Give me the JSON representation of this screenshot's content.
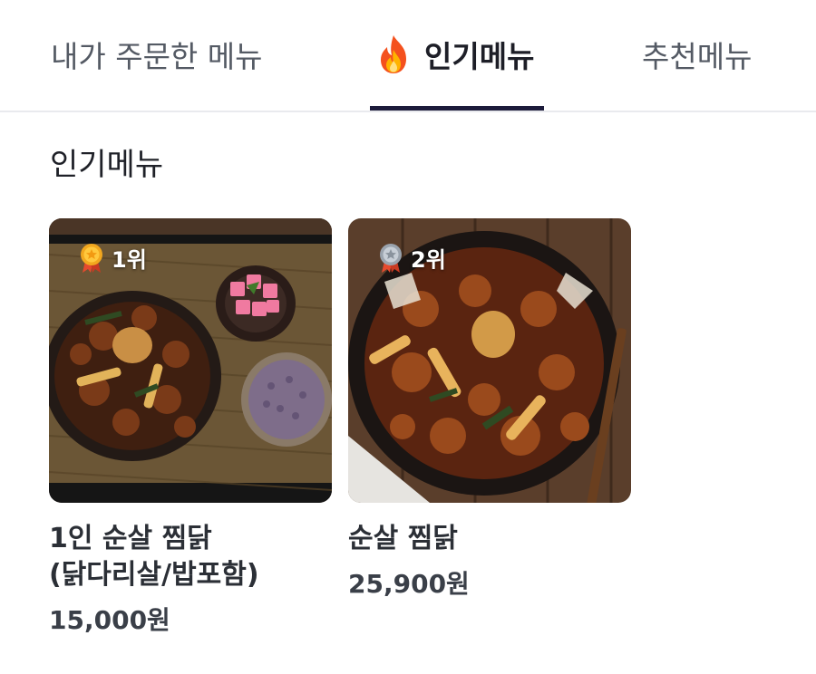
{
  "tabs": [
    {
      "label": "내가 주문한 메뉴",
      "active": false
    },
    {
      "label": "인기메뉴",
      "active": true,
      "icon": "fire-icon"
    },
    {
      "label": "추천메뉴",
      "active": false
    }
  ],
  "section": {
    "title": "인기메뉴"
  },
  "menus": [
    {
      "rank": "1위",
      "rank_icon": "gold-medal-icon",
      "name_line1": "1인 순살 찜닭",
      "name_line2": "(닭다리살/밥포함)",
      "price": "15,000원"
    },
    {
      "rank": "2위",
      "rank_icon": "silver-medal-icon",
      "name_line1": "순살 찜닭",
      "name_line2": "",
      "price": "25,900원"
    }
  ],
  "colors": {
    "accent": "#1c1b3a",
    "gold": "#f2a71e",
    "silver": "#9aa3ad",
    "ribbon": "#e64a2e"
  }
}
